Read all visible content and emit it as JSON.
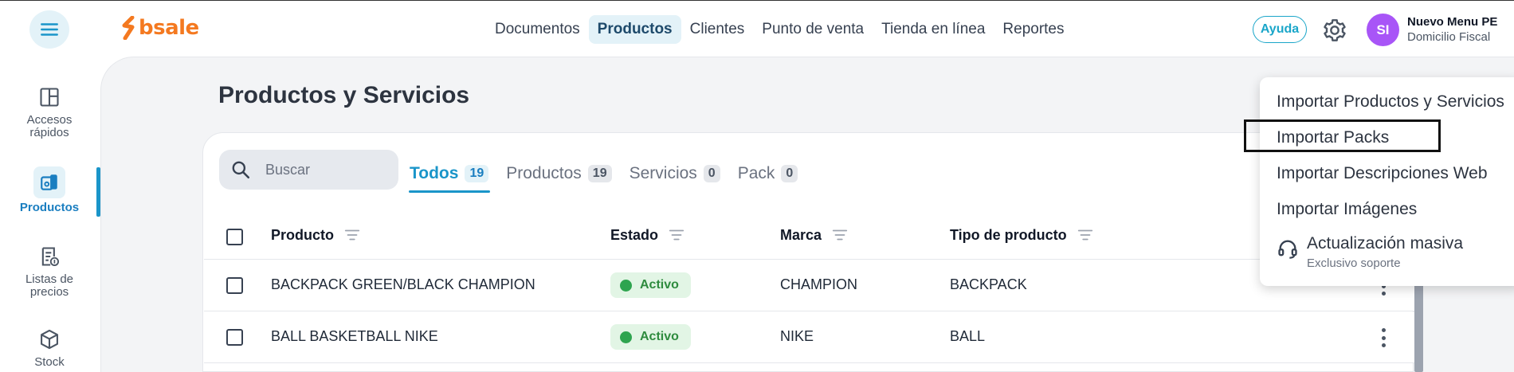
{
  "header": {
    "logo_text": "bsale",
    "nav": [
      {
        "label": "Documentos",
        "active": false
      },
      {
        "label": "Productos",
        "active": true
      },
      {
        "label": "Clientes",
        "active": false
      },
      {
        "label": "Punto de venta",
        "active": false
      },
      {
        "label": "Tienda en línea",
        "active": false
      },
      {
        "label": "Reportes",
        "active": false
      }
    ],
    "help_label": "Ayuda",
    "avatar_initials": "SI",
    "company_name": "Nuevo Menu PE",
    "company_sub": "Domicilio Fiscal"
  },
  "sidebar": {
    "items": [
      {
        "label": "Accesos rápidos",
        "icon": "layout-icon"
      },
      {
        "label": "Productos",
        "icon": "products-icon",
        "active": true
      },
      {
        "label": "Listas de precios",
        "icon": "price-list-icon"
      },
      {
        "label": "Stock",
        "icon": "cube-icon"
      }
    ]
  },
  "page": {
    "title": "Productos y Servicios"
  },
  "search": {
    "placeholder": "Buscar"
  },
  "tabs": [
    {
      "label": "Todos",
      "count": "19",
      "active": true
    },
    {
      "label": "Productos",
      "count": "19"
    },
    {
      "label": "Servicios",
      "count": "0"
    },
    {
      "label": "Pack",
      "count": "0"
    }
  ],
  "table": {
    "columns": [
      "Producto",
      "Estado",
      "Marca",
      "Tipo de producto"
    ],
    "rows": [
      {
        "producto": "BACKPACK GREEN/BLACK CHAMPION",
        "estado": "Activo",
        "marca": "CHAMPION",
        "tipo": "BACKPACK"
      },
      {
        "producto": "BALL BASKETBALL NIKE",
        "estado": "Activo",
        "marca": "NIKE",
        "tipo": "BALL"
      }
    ]
  },
  "dropdown": {
    "items": [
      "Importar Productos y Servicios",
      "Importar Packs",
      "Importar Descripciones Web",
      "Importar Imágenes"
    ],
    "special": {
      "title": "Actualización masiva",
      "subtitle": "Exclusivo soporte"
    }
  },
  "colors": {
    "accent": "#1a95c9",
    "brand_orange": "#f47920",
    "avatar_bg": "#a855f7",
    "status_active": "#2ea44f"
  }
}
